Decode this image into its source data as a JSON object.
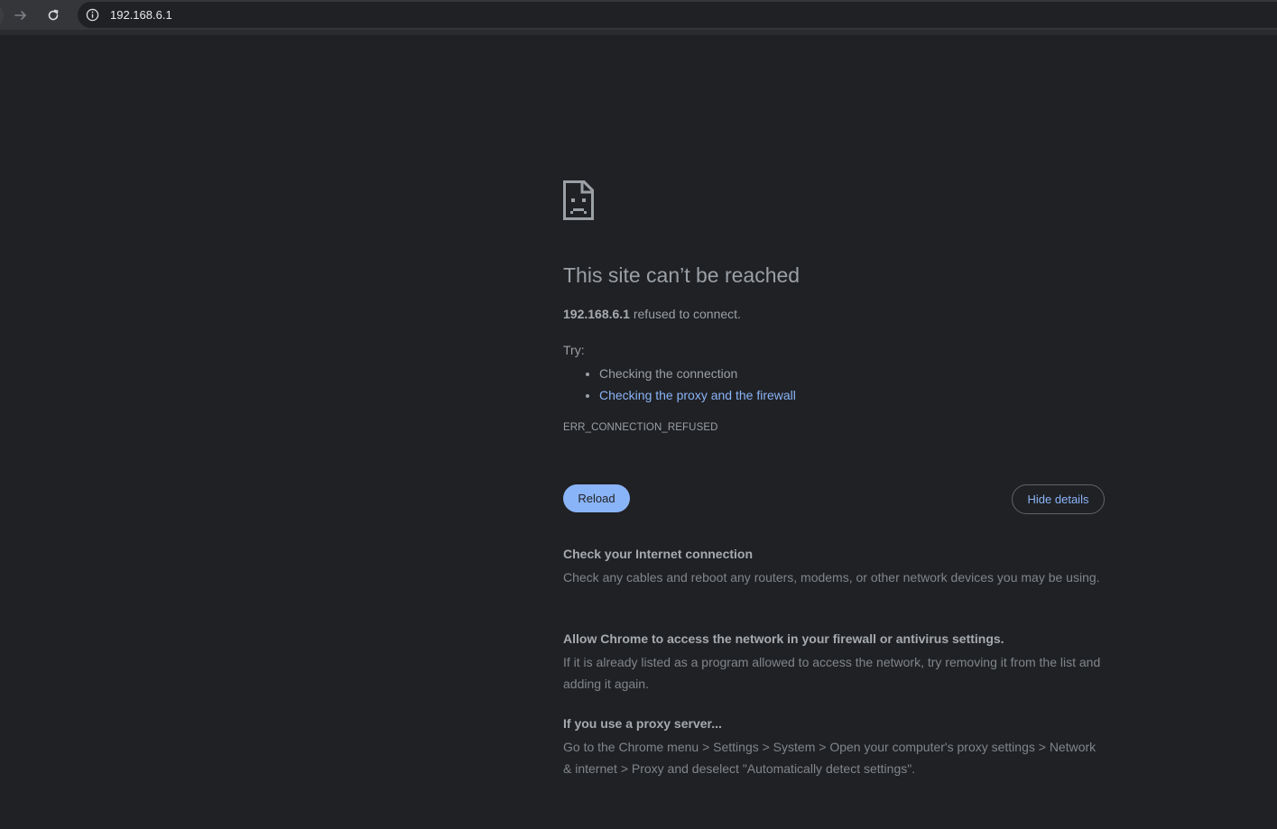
{
  "browser": {
    "url": "192.168.6.1",
    "accent_color": "#8ab4f8"
  },
  "error_page": {
    "title": "This site can’t be reached",
    "host": "192.168.6.1",
    "summary_suffix": " refused to connect.",
    "try_label": "Try:",
    "suggestions": [
      "Checking the connection",
      "Checking the proxy and the firewall"
    ],
    "error_code": "ERR_CONNECTION_REFUSED",
    "reload_label": "Reload",
    "details_label": "Hide details",
    "details": [
      {
        "heading": "Check your Internet connection",
        "body": "Check any cables and reboot any routers, modems, or other network devices you may be using."
      },
      {
        "heading": "Allow Chrome to access the network in your firewall or antivirus settings.",
        "body": "If it is already listed as a program allowed to access the network, try removing it from the list and adding it again."
      },
      {
        "heading": "If you use a proxy server...",
        "body": "Go to the Chrome menu > Settings > System > Open your computer's proxy settings > Network & internet > Proxy and deselect \"Automatically detect settings\"."
      }
    ]
  }
}
